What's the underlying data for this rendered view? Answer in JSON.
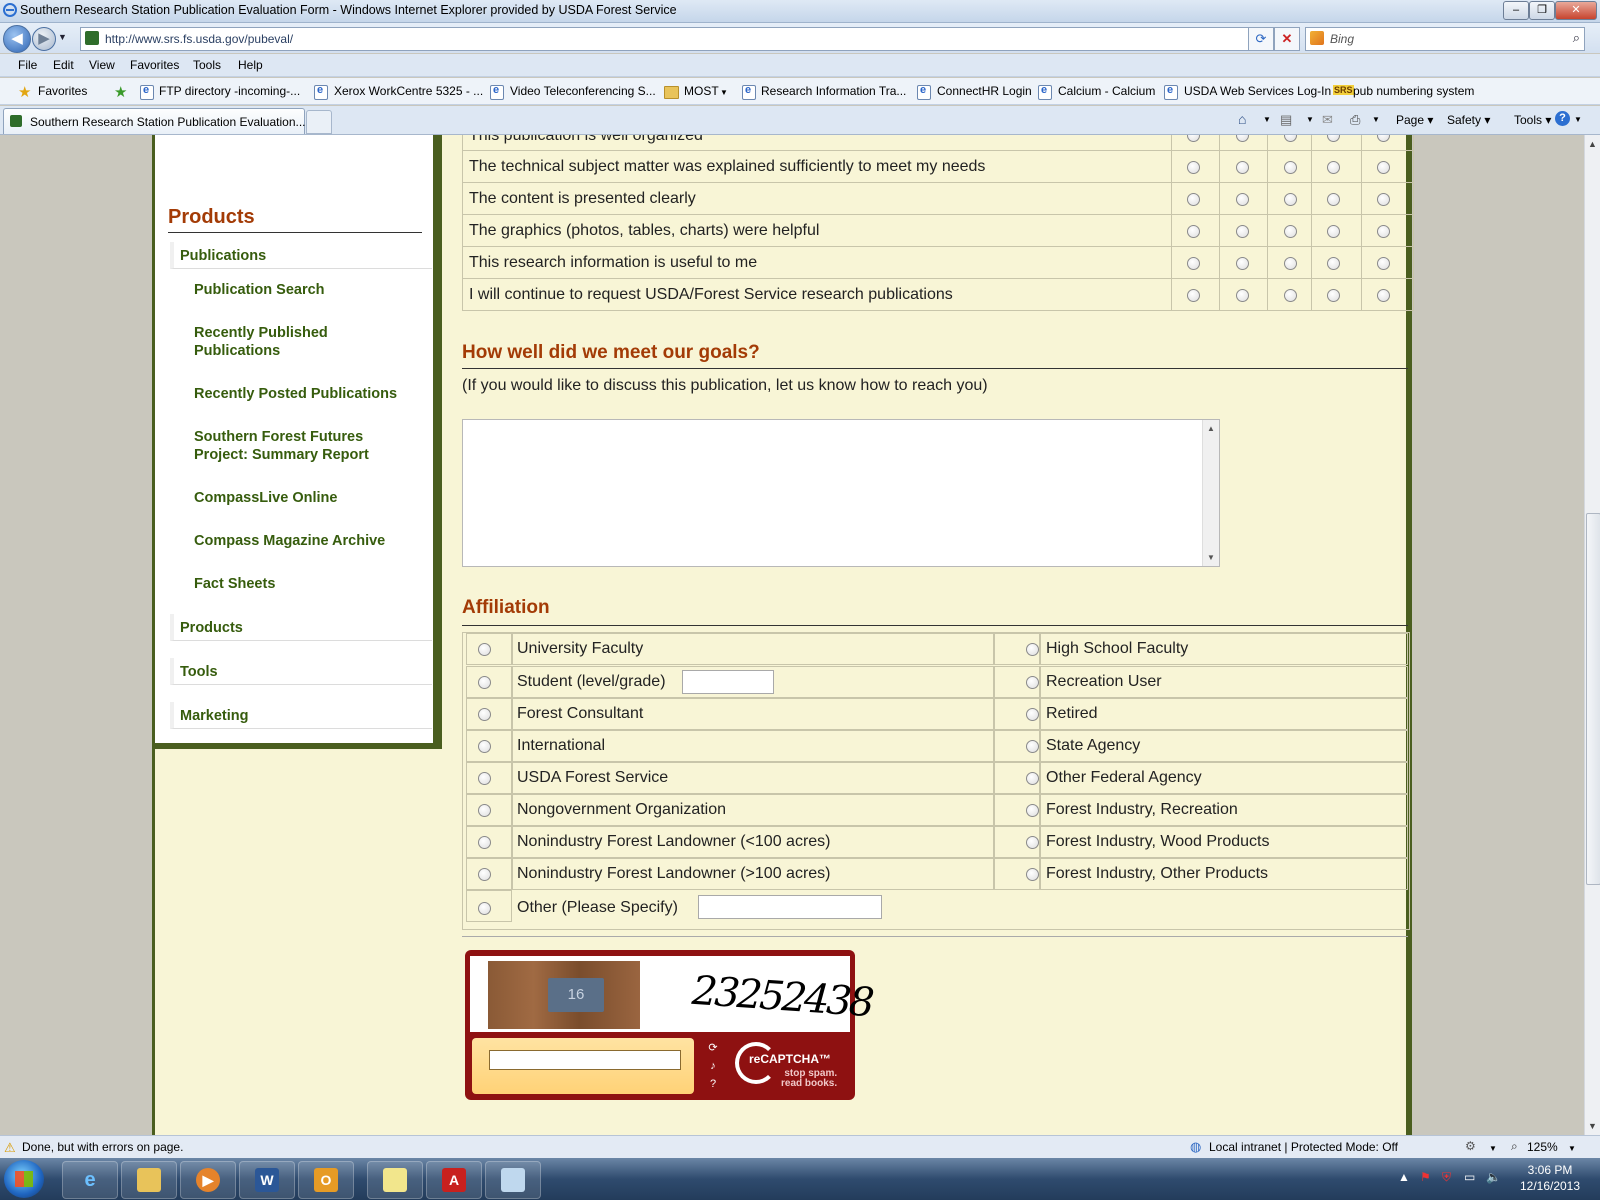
{
  "window": {
    "title": "Southern Research Station Publication Evaluation Form - Windows Internet Explorer provided by USDA Forest Service",
    "buttons": [
      "minimize",
      "maximize",
      "close"
    ]
  },
  "addressbar": {
    "url": "http://www.srs.fs.usda.gov/pubeval/",
    "search_placeholder": "Bing"
  },
  "menubar": [
    "File",
    "Edit",
    "View",
    "Favorites",
    "Tools",
    "Help"
  ],
  "favorites": {
    "label": "Favorites",
    "items": [
      "FTP directory -incoming-...",
      "Xerox WorkCentre 5325 - ...",
      "Video Teleconferencing S...",
      "MOST",
      "Research Information Tra...",
      "ConnectHR Login",
      "Calcium - Calcium",
      "USDA Web Services Log-In",
      "pub numbering system"
    ],
    "srs_badge": "SRS"
  },
  "tabs": {
    "active": "Southern Research Station Publication Evaluation..."
  },
  "commandbar": {
    "page": "Page",
    "safety": "Safety",
    "tools": "Tools"
  },
  "sidebar": {
    "title": "Products",
    "top_items": [
      "Publications",
      "Products",
      "Tools",
      "Marketing"
    ],
    "sub_items": [
      "Publication Search",
      "Recently Published Publications",
      "Recently Posted Publications",
      "Southern Forest Futures Project: Summary Report",
      "CompassLive Online",
      "Compass Magazine Archive",
      "Fact Sheets"
    ]
  },
  "ratings": {
    "partial_row": "This publication is well organized",
    "rows": [
      "The technical subject matter was explained sufficiently to meet my needs",
      "The content is presented clearly",
      "The graphics (photos, tables, charts) were helpful",
      "This research information is useful to me",
      "I will continue to request USDA/Forest Service research publications"
    ]
  },
  "goals": {
    "title": "How well did we meet our goals?",
    "note": "(If you would like to discuss this publication, let us know how to reach you)"
  },
  "affiliation": {
    "title": "Affiliation",
    "left": [
      "University Faculty",
      "Student (level/grade)",
      "Forest Consultant",
      "International",
      "USDA Forest Service",
      "Nongovernment Organization",
      "Nonindustry Forest Landowner (<100 acres)",
      "Nonindustry Forest Landowner (>100 acres)"
    ],
    "right": [
      "High School Faculty",
      "Recreation User",
      "Retired",
      "State Agency",
      "Other Federal Agency",
      "Forest Industry, Recreation",
      "Forest Industry, Wood Products",
      "Forest Industry, Other Products"
    ],
    "other": "Other (Please Specify)"
  },
  "captcha": {
    "plate_number": "16",
    "word": "23252438",
    "brand": "reCAPTCHA™",
    "tagline_1": "stop spam.",
    "tagline_2": "read books."
  },
  "statusbar": {
    "message": "Done, but with errors on page.",
    "zone": "Local intranet | Protected Mode: Off",
    "zoom": "125%"
  },
  "taskbar": {
    "time": "3:06 PM",
    "date": "12/16/2013"
  },
  "colors": {
    "heading": "#a33b06",
    "nav_link": "#365c0d",
    "frame": "#4a5e1f",
    "content_bg": "#f8f5d6"
  }
}
